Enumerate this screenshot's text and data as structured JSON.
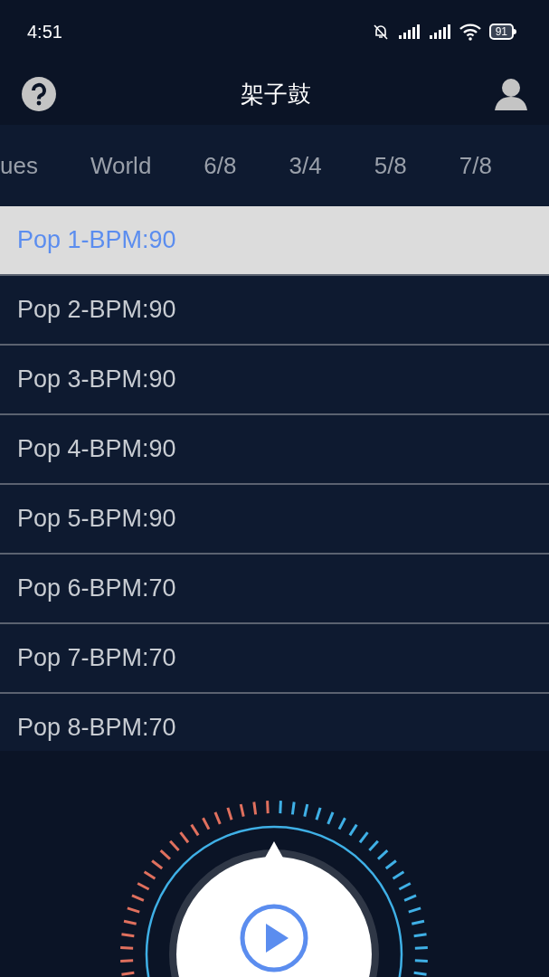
{
  "status_bar": {
    "time": "4:51",
    "battery": "91"
  },
  "header": {
    "title": "架子鼓"
  },
  "tabs": [
    {
      "label": "ues",
      "selected": false
    },
    {
      "label": "World",
      "selected": false
    },
    {
      "label": "6/8",
      "selected": false
    },
    {
      "label": "3/4",
      "selected": false
    },
    {
      "label": "5/8",
      "selected": false
    },
    {
      "label": "7/8",
      "selected": false
    }
  ],
  "rhythms": [
    {
      "label": "Pop 1-BPM:90",
      "selected": true
    },
    {
      "label": "Pop 2-BPM:90",
      "selected": false
    },
    {
      "label": "Pop 3-BPM:90",
      "selected": false
    },
    {
      "label": "Pop 4-BPM:90",
      "selected": false
    },
    {
      "label": "Pop 5-BPM:90",
      "selected": false
    },
    {
      "label": "Pop 6-BPM:70",
      "selected": false
    },
    {
      "label": "Pop 7-BPM:70",
      "selected": false
    },
    {
      "label": "Pop 8-BPM:70",
      "selected": false
    }
  ]
}
